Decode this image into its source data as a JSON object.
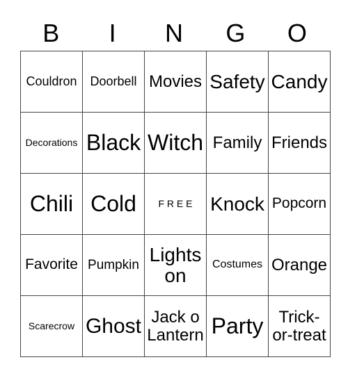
{
  "header": {
    "letters": [
      "B",
      "I",
      "N",
      "G",
      "O"
    ]
  },
  "card": {
    "rows": [
      [
        "Couldron",
        "Doorbell",
        "Movies",
        "Safety",
        "Candy"
      ],
      [
        "Decorations",
        "Black",
        "Witch",
        "Family",
        "Friends"
      ],
      [
        "Chili",
        "Cold",
        "F\nR\nE\nE",
        "Knock",
        "Popcorn"
      ],
      [
        "Favorite",
        "Pumpkin",
        "Lights on",
        "Costumes",
        "Orange"
      ],
      [
        "Scarecrow",
        "Ghost",
        "Jack o Lantern",
        "Party",
        "Trick-or-treat"
      ]
    ],
    "free_space_label": "FREE"
  }
}
